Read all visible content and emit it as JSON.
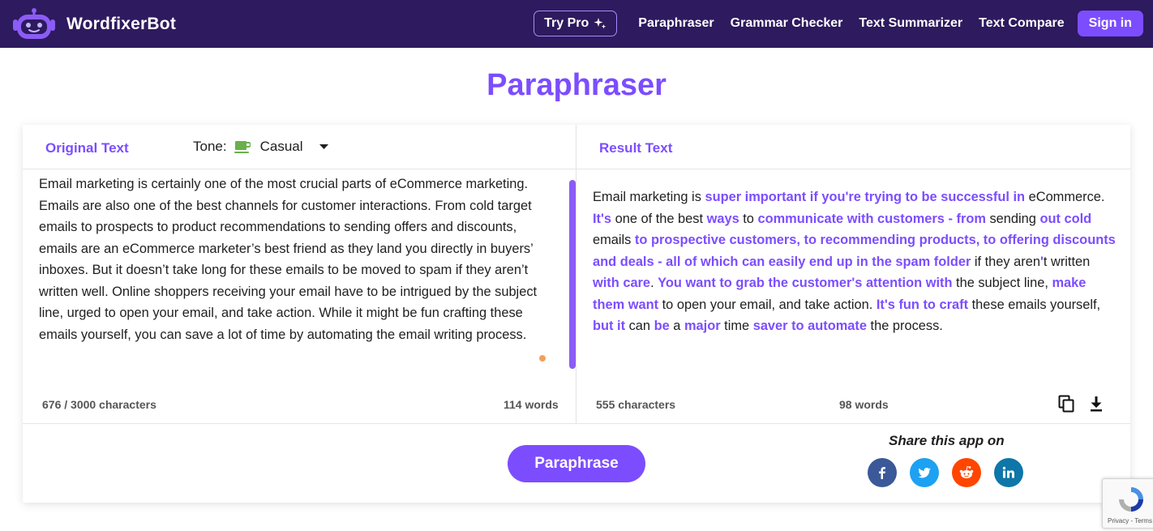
{
  "navbar": {
    "brand": "WordfixerBot",
    "try_pro": "Try Pro",
    "links": [
      "Paraphraser",
      "Grammar Checker",
      "Text Summarizer",
      "Text Compare"
    ],
    "sign_in": "Sign in"
  },
  "page_title": "Paraphraser",
  "input_panel": {
    "label": "Original Text",
    "tone_label": "Tone:",
    "tone_value": "Casual",
    "text": "Email marketing is certainly one of the most crucial parts of eCommerce marketing. Emails are also one of the best channels for customer interactions. From cold target emails to prospects to product recommendations to sending offers and discounts, emails are an eCommerce marketer’s best friend as they land you directly in buyers’ inboxes. But it doesn’t take long for these emails to be moved to spam if they aren’t written well. Online shoppers receiving your email have to be intrigued by the subject line, urged to open your email, and take action. While it might be fun crafting these emails yourself, you can save a lot of time by automating the email writing process.",
    "char_count": "676 / 3000 characters",
    "word_count": "114 words"
  },
  "result_panel": {
    "label": "Result Text",
    "segments": [
      {
        "t": "Email marketing is ",
        "hl": false
      },
      {
        "t": "super important if you're trying to be successful in",
        "hl": true
      },
      {
        "t": " eCommerce. ",
        "hl": false
      },
      {
        "t": "It's",
        "hl": true
      },
      {
        "t": " one of the best ",
        "hl": false
      },
      {
        "t": "ways",
        "hl": true
      },
      {
        "t": " to ",
        "hl": false
      },
      {
        "t": "communicate with customers - from",
        "hl": true
      },
      {
        "t": " sending ",
        "hl": false
      },
      {
        "t": "out cold",
        "hl": true
      },
      {
        "t": " emails ",
        "hl": false
      },
      {
        "t": "to prospective customers, to recommending products, to offering discounts and deals - all of which can easily end up in the spam folder",
        "hl": true
      },
      {
        "t": " if they aren",
        "hl": false
      },
      {
        "t": "'",
        "hl": true
      },
      {
        "t": "t written ",
        "hl": false
      },
      {
        "t": "with care",
        "hl": true
      },
      {
        "t": ". ",
        "hl": false
      },
      {
        "t": "You want to grab the customer's attention with",
        "hl": true
      },
      {
        "t": " the subject line, ",
        "hl": false
      },
      {
        "t": "make them want",
        "hl": true
      },
      {
        "t": " to open your email, and take action. ",
        "hl": false
      },
      {
        "t": "It's fun to craft",
        "hl": true
      },
      {
        "t": " these emails yourself, ",
        "hl": false
      },
      {
        "t": "but it",
        "hl": true
      },
      {
        "t": " can ",
        "hl": false
      },
      {
        "t": "be",
        "hl": true
      },
      {
        "t": " a ",
        "hl": false
      },
      {
        "t": "major",
        "hl": true
      },
      {
        "t": " time ",
        "hl": false
      },
      {
        "t": "saver to automate",
        "hl": true
      },
      {
        "t": " the process.",
        "hl": false
      }
    ],
    "char_count": "555 characters",
    "word_count": "98 words"
  },
  "actions": {
    "paraphrase": "Paraphrase",
    "copy_icon": "copy-icon",
    "download_icon": "download-icon"
  },
  "share": {
    "title": "Share this app on",
    "networks": [
      {
        "name": "facebook",
        "glyph": "f",
        "color": "#3b5998"
      },
      {
        "name": "twitter",
        "glyph": "t",
        "color": "#1da1f2"
      },
      {
        "name": "reddit",
        "glyph": "r",
        "color": "#ff4500"
      },
      {
        "name": "linkedin",
        "glyph": "in",
        "color": "#0e76a8"
      }
    ]
  },
  "recaptcha": {
    "text": "Privacy - Terms"
  },
  "colors": {
    "brand": "#7c4dff",
    "navbar": "#2e1a5e"
  }
}
